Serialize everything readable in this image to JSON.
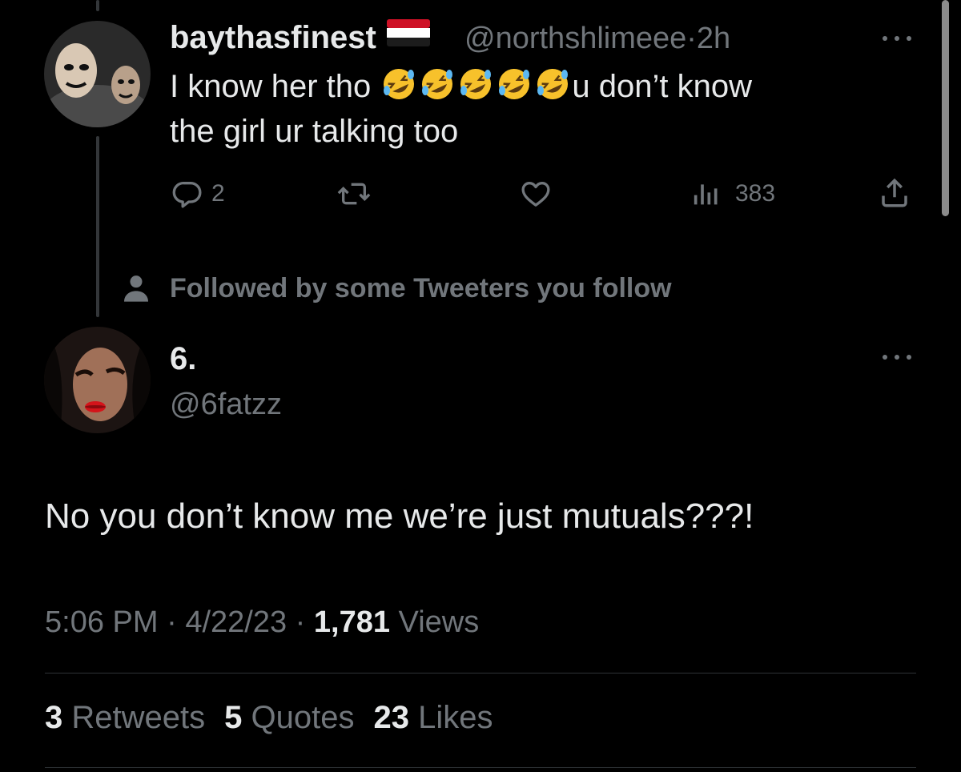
{
  "reply_tweet": {
    "display_name": "baythasfinest",
    "flag_icon": "yemen-flag-icon",
    "handle": "@northshlimeee",
    "separator": "·",
    "time": "2h",
    "text_before_emoji": "I know her tho",
    "emoji_icon": "rolling-on-floor-laughing-icon",
    "text_after_emoji": "u don’t know",
    "text_line2": "the girl ur talking too",
    "reply_count": "2",
    "views_count": "383"
  },
  "social_context": {
    "text": "Followed by some Tweeters you follow"
  },
  "main_tweet": {
    "display_name": "6.",
    "handle": "@6fatzz",
    "text": "No you don’t know me we’re just mutuals???!",
    "time": "5:06 PM",
    "date": "4/22/23",
    "separator": "·",
    "views_count": "1,781",
    "views_label": "Views",
    "retweets_count": "3",
    "retweets_label": "Retweets",
    "quotes_count": "5",
    "quotes_label": "Quotes",
    "likes_count": "23",
    "likes_label": "Likes"
  },
  "colors": {
    "background": "#000000",
    "text_primary": "#e7e9ea",
    "text_secondary": "#71767b",
    "divider": "#2f3336"
  }
}
